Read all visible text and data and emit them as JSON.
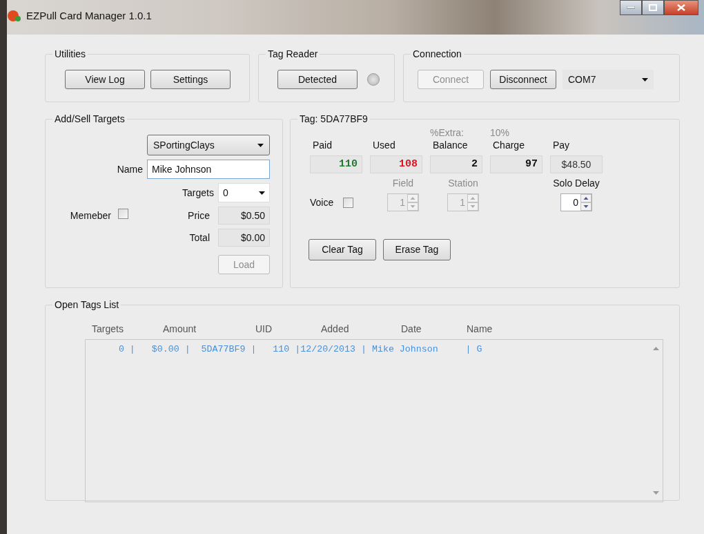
{
  "window": {
    "title": "EZPull Card Manager 1.0.1"
  },
  "utilities": {
    "title": "Utilities",
    "buttons": [
      "View Log",
      "Settings"
    ]
  },
  "tag_reader": {
    "title": "Tag Reader",
    "button": "Detected",
    "indicator_on": false
  },
  "connection": {
    "title": "Connection",
    "buttons": [
      {
        "label": "Connect",
        "disabled": true
      },
      {
        "label": "Disconnect",
        "disabled": false
      }
    ],
    "port": "COM7"
  },
  "add_sell": {
    "title": "Add/Sell Targets",
    "game": "SPortingClays",
    "name_label": "Name",
    "name_value": "Mike Johnson",
    "targets_label": "Targets",
    "targets_value": "0",
    "member_label": "Memeber",
    "member_checked": false,
    "price_label": "Price",
    "price": "$0.50",
    "total_label": "Total",
    "total": "$0.00",
    "load_button": {
      "label": "Load",
      "disabled": true
    }
  },
  "tag": {
    "title": "Tag: 5DA77BF9",
    "stats": [
      {
        "kind": "count",
        "label": "Paid",
        "value": "110",
        "color": "#1f7a2e"
      },
      {
        "kind": "count",
        "label": "Used",
        "value": "108",
        "color": "#e0141e"
      },
      {
        "kind": "count",
        "caption": "%Extra:",
        "label": "Balance",
        "value": "2",
        "color": "#111111"
      },
      {
        "kind": "count",
        "caption": "10%",
        "label": "Charge",
        "value": "97",
        "color": "#111111"
      },
      {
        "kind": "money",
        "label": "Pay",
        "value": "$48.50",
        "color": "#333333"
      }
    ],
    "voice_label": "Voice",
    "voice_checked": false,
    "spinners": [
      {
        "label": "Field",
        "value": "1",
        "disabled": true
      },
      {
        "label": "Station",
        "value": "1",
        "disabled": true
      },
      {
        "label": "Solo Delay",
        "value": "0",
        "disabled": false
      }
    ],
    "buttons": [
      "Clear Tag",
      "Erase Tag"
    ]
  },
  "open_tags": {
    "title": "Open Tags List",
    "columns": [
      "Targets",
      "Amount",
      "UID",
      "Added",
      "Date",
      "Name"
    ],
    "rows": [
      "     0 |   $0.00 |  5DA77BF9 |   110 |12/20/2013 | Mike Johnson     | G"
    ]
  }
}
